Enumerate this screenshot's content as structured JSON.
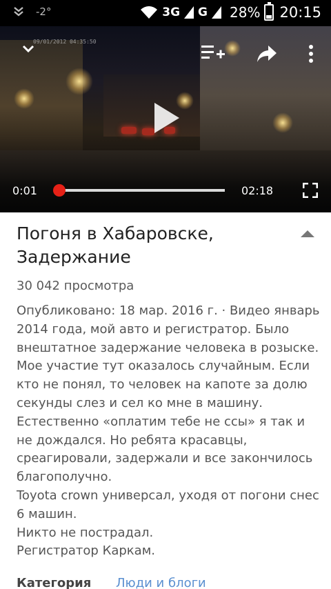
{
  "status_bar": {
    "badge": "-2°",
    "network1": "3G",
    "network2": "G",
    "battery": "28%",
    "battery_level": 0.28,
    "time": "20:15"
  },
  "player": {
    "current_time": "0:01",
    "duration": "02:18",
    "progress": 0.01,
    "stamp": "09/01/2012 04:35:50",
    "icons": [
      "chevron-down-icon",
      "add-to-playlist-icon",
      "share-icon",
      "more-vert-icon",
      "play-icon",
      "fullscreen-icon"
    ]
  },
  "video": {
    "title": "Погоня в Хабаровске, Задержание",
    "views": "30 042 просмотра",
    "description": "Опубликовано: 18 мар. 2016 г. · Видео январь 2014 года, мой авто и регистратор. Было внештатное задержание человека в розыске. Мое участие тут оказалось случайным. Если кто не понял, то человек на капоте за долю секунды слез и сел ко мне в машину. Естественно «оплатим тебе не ссы» я так и не дождался. Но ребята красавцы, среагировали, задержали и все закончилось благополучно.\nToyota crown универсал, уходя от погони снес 6 машин.\nНикто не пострадал.\nРегистратор Каркам.",
    "category_label": "Категория",
    "category_value": "Люди и блоги"
  },
  "colors": {
    "accent": "#e62117",
    "link": "#5a8fd0"
  }
}
